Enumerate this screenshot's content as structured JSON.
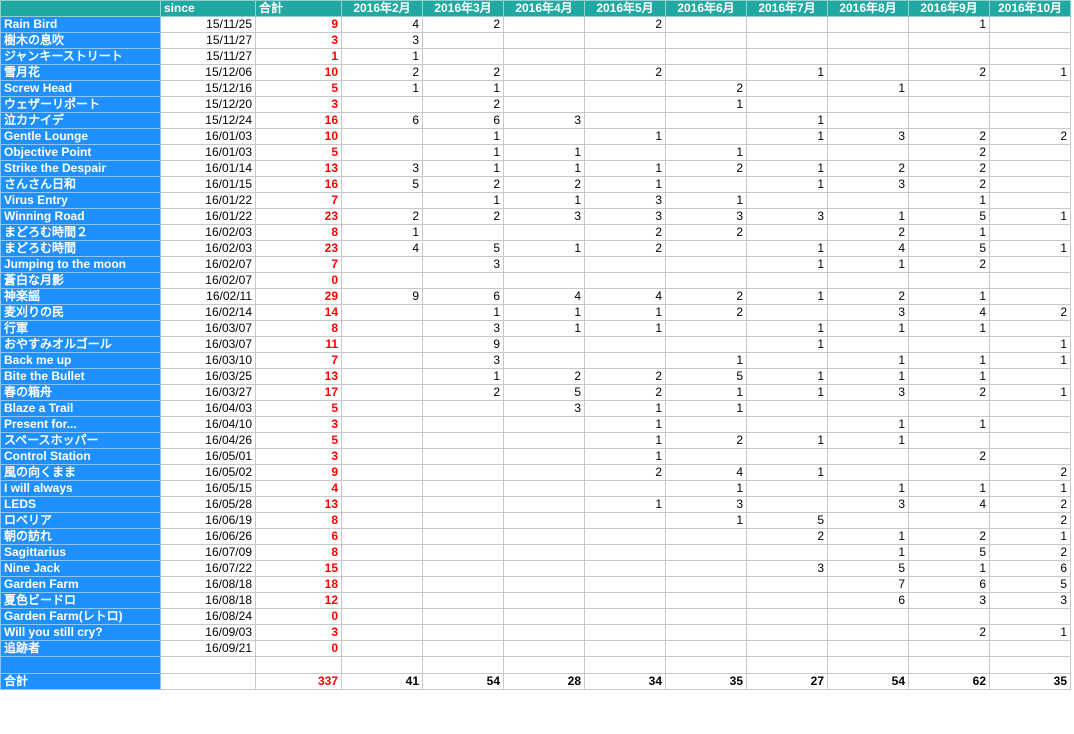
{
  "header": {
    "name_col": "",
    "since": "since",
    "total": "合計",
    "months": [
      "2016年2月",
      "2016年3月",
      "2016年4月",
      "2016年5月",
      "2016年6月",
      "2016年7月",
      "2016年8月",
      "2016年9月",
      "2016年10月"
    ]
  },
  "rows": [
    {
      "name": "Rain Bird",
      "since": "15/11/25",
      "total": "9",
      "m": [
        "4",
        "2",
        "",
        "2",
        "",
        "",
        "",
        "1",
        ""
      ]
    },
    {
      "name": "樹木の息吹",
      "since": "15/11/27",
      "total": "3",
      "m": [
        "3",
        "",
        "",
        "",
        "",
        "",
        "",
        "",
        ""
      ]
    },
    {
      "name": "ジャンキーストリート",
      "since": "15/11/27",
      "total": "1",
      "m": [
        "1",
        "",
        "",
        "",
        "",
        "",
        "",
        "",
        ""
      ]
    },
    {
      "name": "雪月花",
      "since": "15/12/06",
      "total": "10",
      "m": [
        "2",
        "2",
        "",
        "2",
        "",
        "1",
        "",
        "2",
        "1"
      ]
    },
    {
      "name": "Screw Head",
      "since": "15/12/16",
      "total": "5",
      "m": [
        "1",
        "1",
        "",
        "",
        "2",
        "",
        "1",
        "",
        ""
      ]
    },
    {
      "name": "ウェザーリポート",
      "since": "15/12/20",
      "total": "3",
      "m": [
        "",
        "2",
        "",
        "",
        "1",
        "",
        "",
        "",
        ""
      ]
    },
    {
      "name": "泣カナイデ",
      "since": "15/12/24",
      "total": "16",
      "m": [
        "6",
        "6",
        "3",
        "",
        "",
        "1",
        "",
        "",
        ""
      ]
    },
    {
      "name": "Gentle Lounge",
      "since": "16/01/03",
      "total": "10",
      "m": [
        "",
        "1",
        "",
        "1",
        "",
        "1",
        "3",
        "2",
        "2"
      ]
    },
    {
      "name": "Objective Point",
      "since": "16/01/03",
      "total": "5",
      "m": [
        "",
        "1",
        "1",
        "",
        "1",
        "",
        "",
        "2",
        ""
      ]
    },
    {
      "name": "Strike the Despair",
      "since": "16/01/14",
      "total": "13",
      "m": [
        "3",
        "1",
        "1",
        "1",
        "2",
        "1",
        "2",
        "2",
        ""
      ]
    },
    {
      "name": "さんさん日和",
      "since": "16/01/15",
      "total": "16",
      "m": [
        "5",
        "2",
        "2",
        "1",
        "",
        "1",
        "3",
        "2",
        ""
      ]
    },
    {
      "name": "Virus Entry",
      "since": "16/01/22",
      "total": "7",
      "m": [
        "",
        "1",
        "1",
        "3",
        "1",
        "",
        "",
        "1",
        ""
      ]
    },
    {
      "name": "Winning Road",
      "since": "16/01/22",
      "total": "23",
      "m": [
        "2",
        "2",
        "3",
        "3",
        "3",
        "3",
        "1",
        "5",
        "1"
      ]
    },
    {
      "name": "まどろむ時間２",
      "since": "16/02/03",
      "total": "8",
      "m": [
        "1",
        "",
        "",
        "2",
        "2",
        "",
        "2",
        "1",
        ""
      ]
    },
    {
      "name": "まどろむ時間",
      "since": "16/02/03",
      "total": "23",
      "m": [
        "4",
        "5",
        "1",
        "2",
        "",
        "1",
        "4",
        "5",
        "1"
      ]
    },
    {
      "name": "Jumping to the moon",
      "since": "16/02/07",
      "total": "7",
      "m": [
        "",
        "3",
        "",
        "",
        "",
        "1",
        "1",
        "2",
        ""
      ]
    },
    {
      "name": "蒼白な月影",
      "since": "16/02/07",
      "total": "0",
      "m": [
        "",
        "",
        "",
        "",
        "",
        "",
        "",
        "",
        ""
      ]
    },
    {
      "name": "神楽謡",
      "since": "16/02/11",
      "total": "29",
      "m": [
        "9",
        "6",
        "4",
        "4",
        "2",
        "1",
        "2",
        "1",
        ""
      ]
    },
    {
      "name": "麦刈りの民",
      "since": "16/02/14",
      "total": "14",
      "m": [
        "",
        "1",
        "1",
        "1",
        "2",
        "",
        "3",
        "4",
        "2"
      ]
    },
    {
      "name": "行軍",
      "since": "16/03/07",
      "total": "8",
      "m": [
        "",
        "3",
        "1",
        "1",
        "",
        "1",
        "1",
        "1",
        ""
      ]
    },
    {
      "name": "おやすみオルゴール",
      "since": "16/03/07",
      "total": "11",
      "m": [
        "",
        "9",
        "",
        "",
        "",
        "1",
        "",
        "",
        "1"
      ]
    },
    {
      "name": "Back me up",
      "since": "16/03/10",
      "total": "7",
      "m": [
        "",
        "3",
        "",
        "",
        "1",
        "",
        "1",
        "1",
        "1"
      ]
    },
    {
      "name": "Bite the Bullet",
      "since": "16/03/25",
      "total": "13",
      "m": [
        "",
        "1",
        "2",
        "2",
        "5",
        "1",
        "1",
        "1",
        ""
      ]
    },
    {
      "name": "春の箱舟",
      "since": "16/03/27",
      "total": "17",
      "m": [
        "",
        "2",
        "5",
        "2",
        "1",
        "1",
        "3",
        "2",
        "1"
      ]
    },
    {
      "name": "Blaze a Trail",
      "since": "16/04/03",
      "total": "5",
      "m": [
        "",
        "",
        "3",
        "1",
        "1",
        "",
        "",
        "",
        ""
      ]
    },
    {
      "name": "Present for...",
      "since": "16/04/10",
      "total": "3",
      "m": [
        "",
        "",
        "",
        "1",
        "",
        "",
        "1",
        "1",
        ""
      ]
    },
    {
      "name": "スペースホッパー",
      "since": "16/04/26",
      "total": "5",
      "m": [
        "",
        "",
        "",
        "1",
        "2",
        "1",
        "1",
        "",
        ""
      ]
    },
    {
      "name": "Control Station",
      "since": "16/05/01",
      "total": "3",
      "m": [
        "",
        "",
        "",
        "1",
        "",
        "",
        "",
        "2",
        ""
      ]
    },
    {
      "name": "風の向くまま",
      "since": "16/05/02",
      "total": "9",
      "m": [
        "",
        "",
        "",
        "2",
        "4",
        "1",
        "",
        "",
        "2"
      ]
    },
    {
      "name": "I will always",
      "since": "16/05/15",
      "total": "4",
      "m": [
        "",
        "",
        "",
        "",
        "1",
        "",
        "1",
        "1",
        "1"
      ]
    },
    {
      "name": "LEDS",
      "since": "16/05/28",
      "total": "13",
      "m": [
        "",
        "",
        "",
        "1",
        "3",
        "",
        "3",
        "4",
        "2"
      ]
    },
    {
      "name": "ロベリア",
      "since": "16/06/19",
      "total": "8",
      "m": [
        "",
        "",
        "",
        "",
        "1",
        "5",
        "",
        "",
        "2"
      ]
    },
    {
      "name": "朝の訪れ",
      "since": "16/06/26",
      "total": "6",
      "m": [
        "",
        "",
        "",
        "",
        "",
        "2",
        "1",
        "2",
        "1"
      ]
    },
    {
      "name": "Sagittarius",
      "since": "16/07/09",
      "total": "8",
      "m": [
        "",
        "",
        "",
        "",
        "",
        "",
        "1",
        "5",
        "2"
      ]
    },
    {
      "name": "Nine Jack",
      "since": "16/07/22",
      "total": "15",
      "m": [
        "",
        "",
        "",
        "",
        "",
        "3",
        "5",
        "1",
        "6"
      ]
    },
    {
      "name": "Garden Farm",
      "since": "16/08/18",
      "total": "18",
      "m": [
        "",
        "",
        "",
        "",
        "",
        "",
        "7",
        "6",
        "5"
      ]
    },
    {
      "name": "夏色ビードロ",
      "since": "16/08/18",
      "total": "12",
      "m": [
        "",
        "",
        "",
        "",
        "",
        "",
        "6",
        "3",
        "3"
      ]
    },
    {
      "name": "Garden Farm(レトロ)",
      "since": "16/08/24",
      "total": "0",
      "m": [
        "",
        "",
        "",
        "",
        "",
        "",
        "",
        "",
        ""
      ]
    },
    {
      "name": "Will you still cry?",
      "since": "16/09/03",
      "total": "3",
      "m": [
        "",
        "",
        "",
        "",
        "",
        "",
        "",
        "2",
        "1"
      ]
    },
    {
      "name": "追跡者",
      "since": "16/09/21",
      "total": "0",
      "m": [
        "",
        "",
        "",
        "",
        "",
        "",
        "",
        "",
        ""
      ]
    }
  ],
  "summary": {
    "label": "合計",
    "total": "337",
    "m": [
      "41",
      "54",
      "28",
      "34",
      "35",
      "27",
      "54",
      "62",
      "35"
    ]
  },
  "colors": {
    "header_bg": "#20a8a2",
    "name_bg": "#1e90ff",
    "total_text": "#ff0000"
  }
}
